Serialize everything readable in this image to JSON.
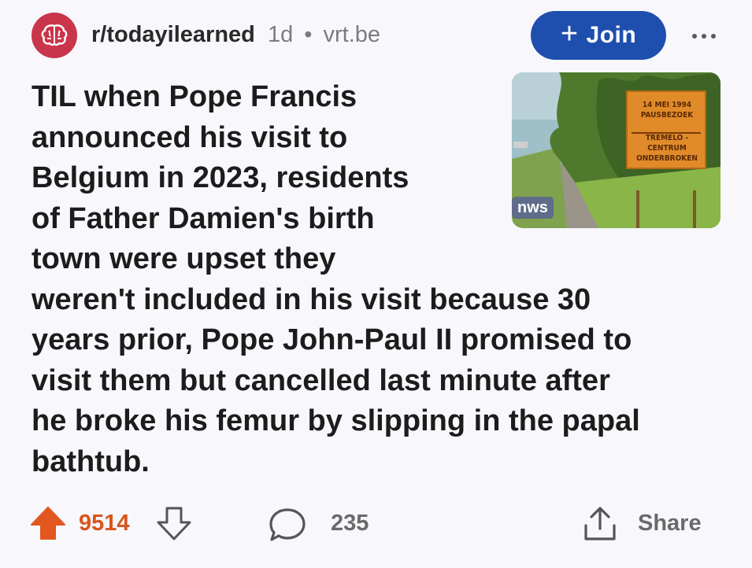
{
  "post": {
    "subreddit": "r/todayilearned",
    "age": "1d",
    "separator": "•",
    "domain": "vrt.be",
    "join_label": "Join",
    "join_icon": "plus-icon",
    "more_icon": "more-icon",
    "title_lines": [
      "TIL when Pope Francis",
      "announced his visit to",
      "Belgium in 2023, residents",
      "of Father Damien's birth",
      "town were upset they",
      "weren't included in his visit because 30",
      "years prior, Pope John-Paul II promised to",
      "visit them but cancelled last minute after",
      "he broke his femur by slipping in the papal",
      "bathtub."
    ]
  },
  "thumbnail": {
    "badge": "nws",
    "sign_line1": "14 MEI 1994",
    "sign_line2": "PAUSBEZOEK",
    "sign_line3": "TREMELO - CENTRUM",
    "sign_line4": "ONDERBROKEN"
  },
  "actions": {
    "score": "9514",
    "comments": "235",
    "share_label": "Share"
  },
  "colors": {
    "join_bg": "#1f4fae",
    "upvote": "#e2561f",
    "subreddit_avatar": "#c9354a",
    "background": "#f8f7fc"
  }
}
